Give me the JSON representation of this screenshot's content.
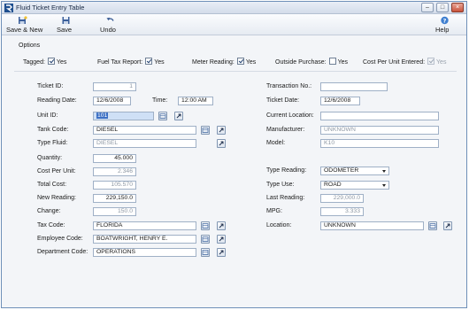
{
  "window": {
    "title": "Fluid Ticket Entry Table"
  },
  "toolbar": {
    "save_new": "Save & New",
    "save": "Save",
    "undo": "Undo",
    "help": "Help"
  },
  "options": {
    "section_label": "Options",
    "tagged": {
      "label": "Tagged:",
      "text": "Yes",
      "checked": true
    },
    "fuel_tax_report": {
      "label": "Fuel Tax Report:",
      "text": "Yes",
      "checked": true
    },
    "meter_reading": {
      "label": "Meter Reading:",
      "text": "Yes",
      "checked": true
    },
    "outside_purchase": {
      "label": "Outside Purchase:",
      "text": "Yes",
      "checked": false
    },
    "cost_per_unit_entered": {
      "label": "Cost Per Unit Entered:",
      "text": "Yes",
      "checked": true,
      "disabled": true
    }
  },
  "left": {
    "ticket_id": {
      "label": "Ticket ID:",
      "value": "1"
    },
    "reading_date": {
      "label": "Reading Date:",
      "value": "12/6/2008"
    },
    "time": {
      "label": "Time:",
      "value": "12:00 AM"
    },
    "unit_id": {
      "label": "Unit ID:",
      "value": "101"
    },
    "tank_code": {
      "label": "Tank Code:",
      "value": "DIESEL"
    },
    "type_fluid": {
      "label": "Type Fluid:",
      "value": "DIESEL"
    },
    "quantity": {
      "label": "Quantity:",
      "value": "45.000"
    },
    "cost_per_unit": {
      "label": "Cost Per Unit:",
      "value": "2.346"
    },
    "total_cost": {
      "label": "Total Cost:",
      "value": "105.570"
    },
    "new_reading": {
      "label": "New Reading:",
      "value": "229,150.0"
    },
    "change": {
      "label": "Change:",
      "value": "150.0"
    },
    "tax_code": {
      "label": "Tax Code:",
      "value": "FLORIDA"
    },
    "employee_code": {
      "label": "Employee Code:",
      "value": "BOATWRIGHT, HENRY E."
    },
    "department_code": {
      "label": "Department Code:",
      "value": "OPERATIONS"
    }
  },
  "right": {
    "transaction_no": {
      "label": "Transaction No.:",
      "value": ""
    },
    "ticket_date": {
      "label": "Ticket Date:",
      "value": "12/6/2008"
    },
    "current_location": {
      "label": "Current Location:",
      "value": ""
    },
    "manufacturer": {
      "label": "Manufacturer:",
      "value": "UNKNOWN"
    },
    "model": {
      "label": "Model:",
      "value": "K10"
    },
    "type_reading": {
      "label": "Type Reading:",
      "value": "ODOMETER"
    },
    "type_use": {
      "label": "Type Use:",
      "value": "ROAD"
    },
    "last_reading": {
      "label": "Last Reading:",
      "value": "229,000.0"
    },
    "mpg": {
      "label": "MPG:",
      "value": "3.333"
    },
    "location": {
      "label": "Location:",
      "value": "UNKNOWN"
    }
  },
  "colors": {
    "title_bar": "#d3dcea",
    "window_bg": "#f3f5f8",
    "field_border": "#9fb0c6",
    "selection": "#3b6fc4",
    "close_button": "#c9533b"
  },
  "icons": {
    "app": "app-logo-icon",
    "save_new": "save-new-icon",
    "save": "floppy-disk-icon",
    "undo": "undo-arrow-icon",
    "help": "help-question-icon",
    "lookup": "lookup-grid-icon",
    "goto": "goto-arrow-icon"
  }
}
